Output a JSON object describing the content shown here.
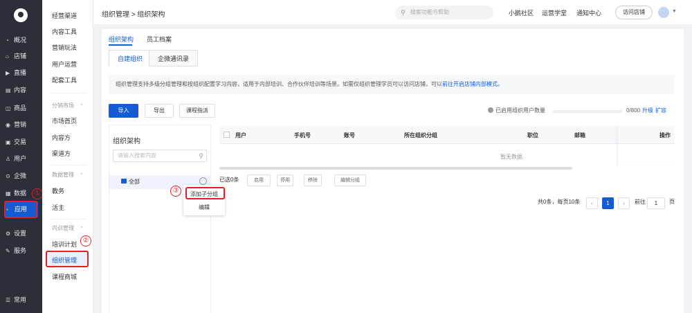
{
  "sidebar": {
    "items": [
      {
        "icon": "◔",
        "label": "概况"
      },
      {
        "icon": "⌂",
        "label": "店铺"
      },
      {
        "icon": "▶",
        "label": "直播"
      },
      {
        "icon": "▤",
        "label": "内容"
      },
      {
        "icon": "◫",
        "label": "商品"
      },
      {
        "icon": "◉",
        "label": "营销"
      },
      {
        "icon": "▣",
        "label": "交易"
      },
      {
        "icon": "♙",
        "label": "用户"
      },
      {
        "icon": "⊙",
        "label": "企微"
      },
      {
        "icon": "▦",
        "label": "数据"
      },
      {
        "icon": "▪",
        "label": "应用"
      },
      {
        "icon": "⚙",
        "label": "设置"
      },
      {
        "icon": "✎",
        "label": "服务"
      }
    ],
    "bottom": {
      "icon": "☰",
      "label": "常用"
    }
  },
  "subnav": {
    "items_top": [
      "经营渠道",
      "内容工具",
      "营销玩法",
      "用户运营",
      "配套工具"
    ],
    "group1": {
      "title": "分销市场",
      "items": [
        "市场首页",
        "内容方",
        "渠道方"
      ]
    },
    "group2": {
      "title": "数据管理",
      "items": [
        "教务",
        "活主"
      ]
    },
    "group3": {
      "title": "内训管理",
      "items": [
        "培训计划",
        "组织管理",
        "课程商城"
      ]
    }
  },
  "topbar": {
    "breadcrumb": "组织管理 > 组织架构",
    "search_placeholder": "搜索功能与帮助",
    "links": [
      "小鹅社区",
      "运营学堂",
      "通知中心"
    ],
    "visit_store": "访问店铺"
  },
  "tabs": [
    "组织架构",
    "员工档案"
  ],
  "subtabs": [
    "自建组织",
    "企微通讯录"
  ],
  "notice": {
    "text": "组织管理支持多级分组管理和按组织配置学习内容，适用于内部培训、合作伙伴培训等场景。如需仅组织管理学员可以访问店铺，可以",
    "link": "前往开启店铺内部模式。"
  },
  "actions": {
    "import": "导入",
    "export": "导出",
    "course_manage": "课程指派"
  },
  "quota": {
    "label": "已启用组织用户数量",
    "used_fraction": 0.0,
    "value": "0/800",
    "upgrade": "升级",
    "expand": "扩容"
  },
  "tree": {
    "title": "组织架构",
    "search_placeholder": "请输入搜索内容",
    "root": "全部",
    "more": "···"
  },
  "popmenu": {
    "add_child": "添加子分组",
    "edit": "编辑"
  },
  "table": {
    "columns": [
      "用户",
      "手机号",
      "账号",
      "所在组织分组",
      "职位",
      "邮箱",
      "操作"
    ],
    "empty": "暂无数据"
  },
  "selection": {
    "label": "已选0条",
    "buttons": [
      "启用",
      "停用",
      "移除",
      "编辑分组"
    ]
  },
  "pagination": {
    "total": "共0条，每页10条",
    "prev": "‹",
    "current": "1",
    "next": "›",
    "goto": "前往",
    "page_input": "1",
    "page_unit": "页"
  },
  "annotations": [
    "①",
    "②",
    "③"
  ],
  "colors": {
    "accent": "#155bd4",
    "sidebar": "#2b2f3a",
    "annotation": "#e02020"
  }
}
